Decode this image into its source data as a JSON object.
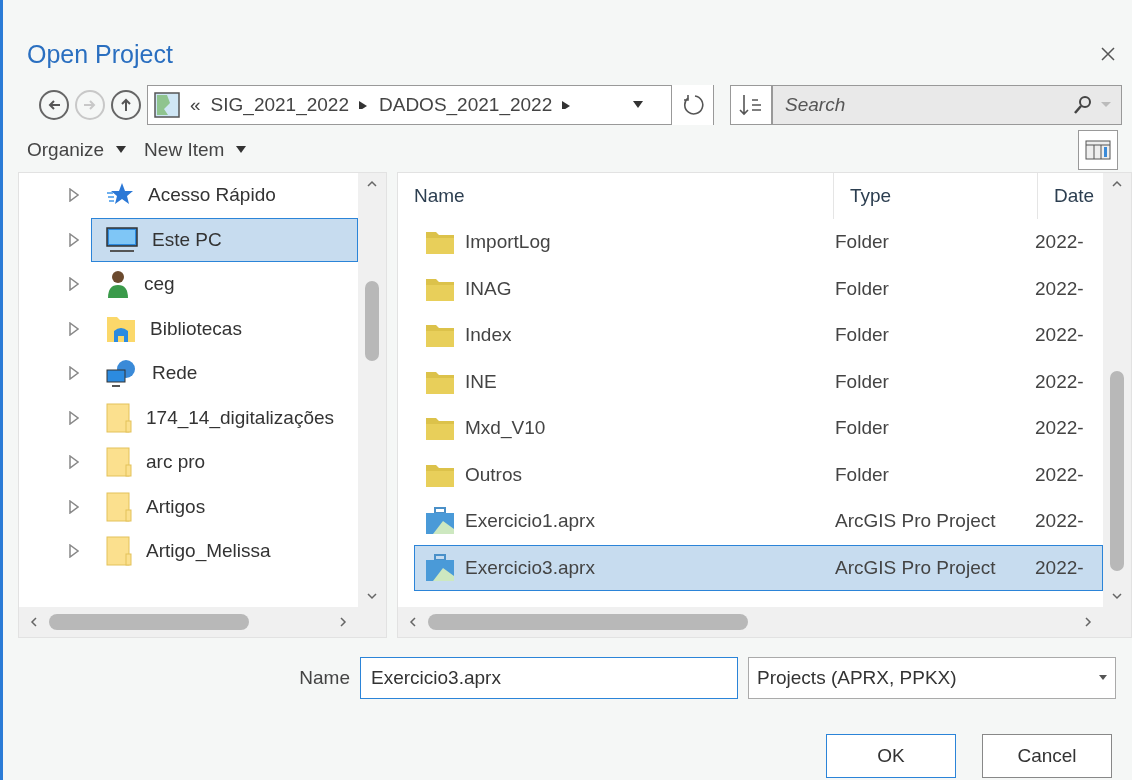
{
  "window": {
    "title": "Open Project"
  },
  "nav": {
    "back": {
      "disabled": false
    },
    "forward": {
      "disabled": true
    },
    "up": {
      "disabled": false
    }
  },
  "breadcrumb": {
    "overflow": "«",
    "parts": [
      "SIG_2021_2022",
      "DADOS_2021_2022"
    ]
  },
  "search": {
    "placeholder": "Search"
  },
  "commands": [
    "Organize",
    "New Item"
  ],
  "tree": {
    "items": [
      {
        "label": "Acesso Rápido",
        "kind": "star",
        "selected": false
      },
      {
        "label": "Este PC",
        "kind": "pc",
        "selected": true
      },
      {
        "label": "ceg",
        "kind": "user",
        "selected": false
      },
      {
        "label": "Bibliotecas",
        "kind": "library",
        "selected": false
      },
      {
        "label": "Rede",
        "kind": "network",
        "selected": false
      },
      {
        "label": "174_14_digitalizações",
        "kind": "folder",
        "selected": false
      },
      {
        "label": "arc pro",
        "kind": "folder",
        "selected": false
      },
      {
        "label": "Artigos",
        "kind": "folder",
        "selected": false
      },
      {
        "label": "Artigo_Melissa",
        "kind": "folder",
        "selected": false
      }
    ]
  },
  "files": {
    "columns": [
      "Name",
      "Type",
      "Date"
    ],
    "rows": [
      {
        "name": "ImportLog",
        "type": "Folder",
        "date": "2022-",
        "kind": "folder",
        "selected": false
      },
      {
        "name": "INAG",
        "type": "Folder",
        "date": "2022-",
        "kind": "folder",
        "selected": false
      },
      {
        "name": "Index",
        "type": "Folder",
        "date": "2022-",
        "kind": "folder",
        "selected": false
      },
      {
        "name": "INE",
        "type": "Folder",
        "date": "2022-",
        "kind": "folder",
        "selected": false
      },
      {
        "name": "Mxd_V10",
        "type": "Folder",
        "date": "2022-",
        "kind": "folder",
        "selected": false
      },
      {
        "name": "Outros",
        "type": "Folder",
        "date": "2022-",
        "kind": "folder",
        "selected": false
      },
      {
        "name": "Exercicio1.aprx",
        "type": "ArcGIS Pro Project",
        "date": "2022-",
        "kind": "project",
        "selected": false
      },
      {
        "name": "Exercicio3.aprx",
        "type": "ArcGIS Pro Project",
        "date": "2022-",
        "kind": "project",
        "selected": true
      }
    ]
  },
  "name_field": {
    "label": "Name",
    "value": "Exercicio3.aprx"
  },
  "filter": {
    "value": "Projects (APRX, PPKX)"
  },
  "buttons": [
    "OK",
    "Cancel"
  ]
}
